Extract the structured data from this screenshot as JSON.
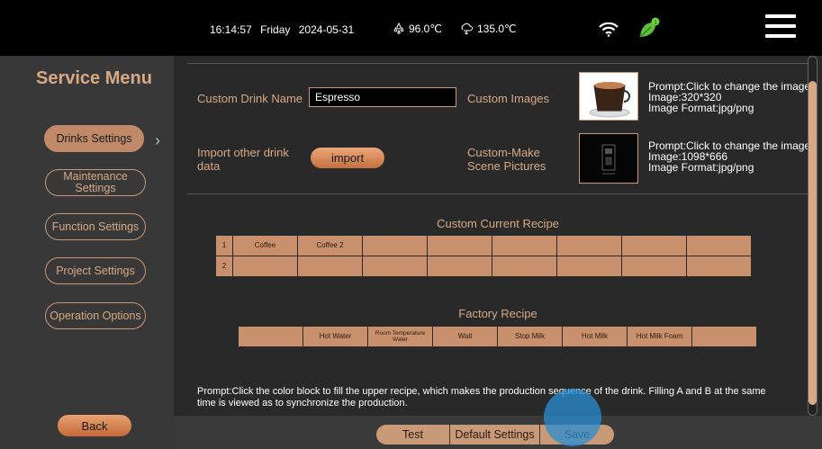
{
  "status": {
    "time": "16:14:57",
    "day": "Friday",
    "date": "2024-05-31",
    "temp1": "96.0℃",
    "temp2": "135.0℃",
    "leaf_badge": "1"
  },
  "sidebar": {
    "title": "Service Menu",
    "items": [
      {
        "label": "Drinks Settings",
        "active": true
      },
      {
        "label": "Maintenance Settings",
        "active": false
      },
      {
        "label": "Function Settings",
        "active": false
      },
      {
        "label": "Project Settings",
        "active": false
      },
      {
        "label": "Operation Options",
        "active": false
      }
    ],
    "back_label": "Back"
  },
  "form": {
    "drink_name_label": "Custom Drink Name",
    "drink_name_value": "Espresso",
    "custom_images_label": "Custom Images",
    "images_hint": {
      "line1": "Prompt:Click to change the image",
      "line2": "Image:320*320",
      "line3": "Image Format:jpg/png"
    },
    "import_label": "Import other drink data",
    "import_button": "import",
    "scene_label": "Custom-Make Scene Pictures",
    "scene_hint": {
      "line1": "Prompt:Click to change the image",
      "line2": "Image:1098*666",
      "line3": "Image Format:jpg/png"
    }
  },
  "custom_recipe": {
    "title": "Custom Current Recipe",
    "rows": [
      {
        "num": "1",
        "cells": [
          "Coffee",
          "Coffee 2",
          "",
          "",
          "",
          "",
          "",
          ""
        ]
      },
      {
        "num": "2",
        "cells": [
          "",
          "",
          "",
          "",
          "",
          "",
          "",
          ""
        ]
      }
    ]
  },
  "factory_recipe": {
    "title": "Factory Recipe",
    "cells": [
      "",
      "Hot Water",
      "Room Temperature Water",
      "Wait",
      "Stop Milk",
      "Hot Milk",
      "Hot Milk Foam",
      ""
    ]
  },
  "prompt": "Prompt:Click the color block to fill the upper recipe, which makes the production sequence of the drink. Filling A and B at the same time is viewed as to synchronize the production.",
  "actions": {
    "test": "Test",
    "default": "Default Settings",
    "save": "Save"
  },
  "colors": {
    "accent": "#c8906c",
    "panel": "#292929",
    "sidebar": "#383838"
  }
}
